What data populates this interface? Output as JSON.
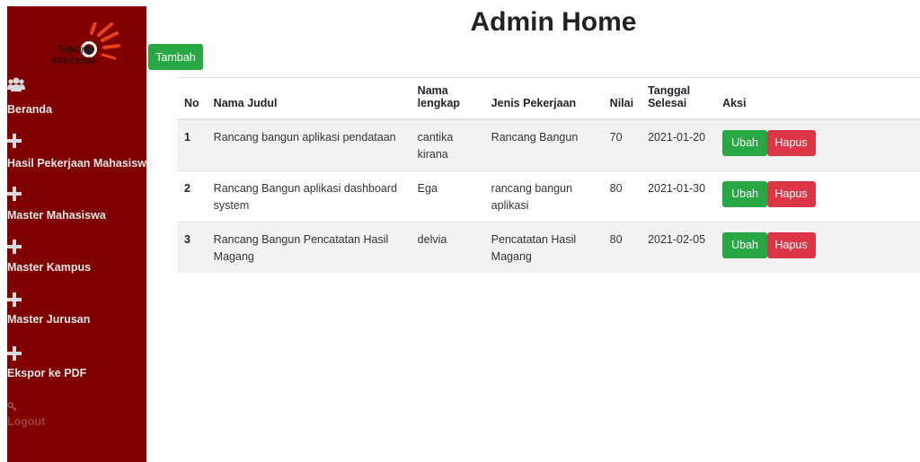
{
  "sidebar": {
    "logo_line1": "Telkom",
    "logo_line2": "Indonesia",
    "items": [
      {
        "label": "Beranda",
        "icon": "users-icon"
      },
      {
        "label": "Hasil Pekerjaan Mahasiswa",
        "icon": "plus-icon"
      },
      {
        "label": "Master Mahasiswa",
        "icon": "plus-icon"
      },
      {
        "label": "Master Kampus",
        "icon": "plus-icon"
      },
      {
        "label": "Master Jurusan",
        "icon": "plus-icon"
      },
      {
        "label": "Ekspor ke PDF",
        "icon": "plus-icon"
      },
      {
        "label": "Logout",
        "icon": "key-icon"
      }
    ]
  },
  "page": {
    "title": "Admin Home",
    "add_button": "Tambah"
  },
  "table": {
    "headers": {
      "no": "No",
      "nama_judul": "Nama Judul",
      "nama_lengkap_1": "Nama",
      "nama_lengkap_2": "lengkap",
      "jenis": "Jenis Pekerjaan",
      "nilai": "Nilai",
      "tanggal_1": "Tanggal",
      "tanggal_2": "Selesai",
      "aksi": "Aksi"
    },
    "rows": [
      {
        "no": "1",
        "judul": "Rancang bangun aplikasi pendataan",
        "nama": "cantika kirana",
        "jenis": "Rancang Bangun",
        "nilai": "70",
        "tanggal": "2021-01-20",
        "ubah": "Ubah",
        "hapus": "Hapus"
      },
      {
        "no": "2",
        "judul": "Rancang Bangun aplikasi dashboard system",
        "nama": "Ega",
        "jenis": "rancang bangun aplikasi",
        "nilai": "80",
        "tanggal": "2021-01-30",
        "ubah": "Ubah",
        "hapus": "Hapus"
      },
      {
        "no": "3",
        "judul": "Rancang Bangun Pencatatan Hasil Magang",
        "nama": "delvia",
        "jenis": "Pencatatan Hasil Magang",
        "nilai": "80",
        "tanggal": "2021-02-05",
        "ubah": "Ubah",
        "hapus": "Hapus"
      }
    ]
  },
  "colors": {
    "sidebar_bg": "#800000",
    "success": "#28a745",
    "danger": "#dc3545"
  }
}
